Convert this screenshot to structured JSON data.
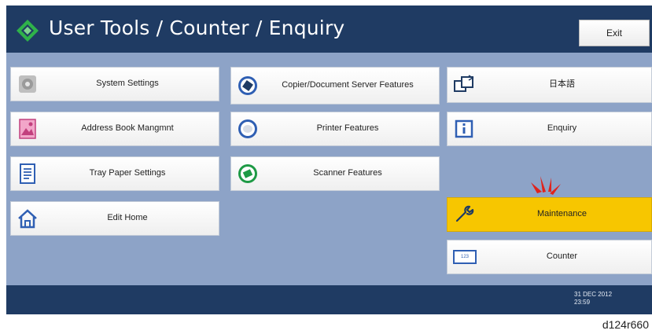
{
  "header": {
    "title": "User Tools / Counter / Enquiry",
    "exit_label": "Exit",
    "logo_icon": "green-diamond-logo-icon",
    "bg_color": "#1f3b63"
  },
  "column1": [
    {
      "label": "System Settings",
      "icon": "gear-icon"
    },
    {
      "label": "Address Book Mangmnt",
      "icon": "address-book-icon"
    },
    {
      "label": "Tray Paper Settings",
      "icon": "tray-paper-icon"
    },
    {
      "label": "Edit Home",
      "icon": "home-icon"
    }
  ],
  "column2": [
    {
      "label": "Copier/Document Server Features",
      "icon": "copier-icon"
    },
    {
      "label": "Printer Features",
      "icon": "printer-icon"
    },
    {
      "label": "Scanner Features",
      "icon": "scanner-icon"
    }
  ],
  "column3": [
    {
      "label": "日本語",
      "icon": "language-switch-icon"
    },
    {
      "label": "Enquiry",
      "icon": "info-icon"
    },
    {
      "label": "Maintenance",
      "icon": "wrench-icon",
      "highlight_color": "#f7c600"
    },
    {
      "label": "Counter",
      "icon": "counter-icon",
      "icon_text": "123"
    }
  ],
  "attention_marker": {
    "icon": "attention-burst-icon",
    "color": "#e0231c"
  },
  "footer": {
    "date": "31 DEC 2012",
    "time": "23:59"
  },
  "reference_code": "d124r660"
}
